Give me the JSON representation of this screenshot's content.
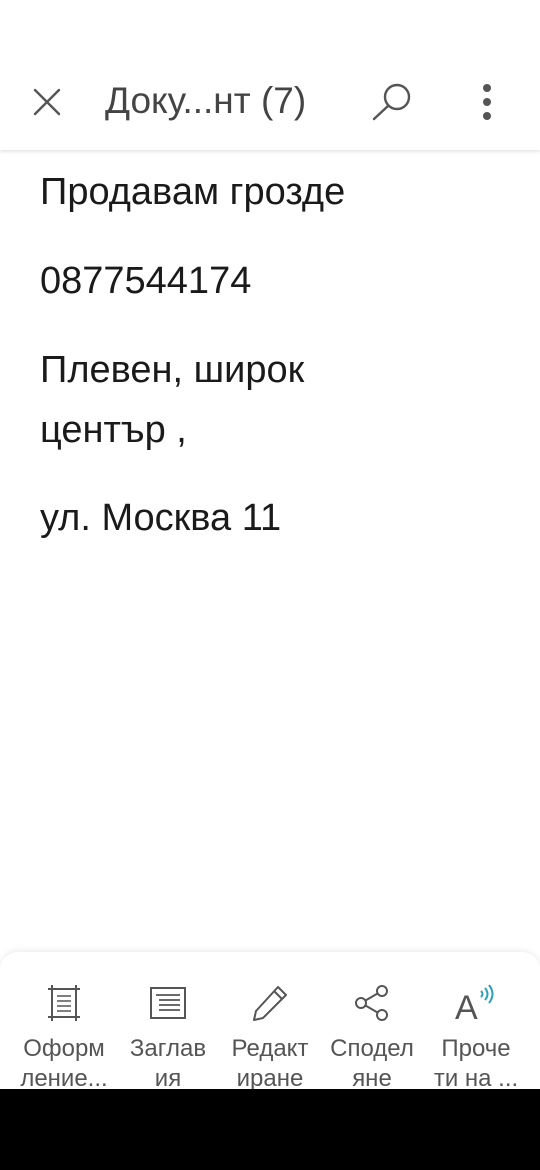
{
  "app_bar": {
    "title": "Доку...нт (7)",
    "close_icon": "close-icon",
    "search_icon": "search-icon",
    "more_icon": "more-vertical-icon"
  },
  "document": {
    "paragraphs": [
      "Продавам грозде",
      "0877544174",
      "Плевен, широк\nцентър ,",
      "ул. Москва 11"
    ]
  },
  "toolbar": {
    "items": [
      {
        "label": "Оформ\nление...",
        "icon": "layout-icon"
      },
      {
        "label": "Заглав\nия",
        "icon": "headings-icon"
      },
      {
        "label": "Редакт\nиране",
        "icon": "pencil-icon"
      },
      {
        "label": "Сподел\nяне",
        "icon": "share-icon"
      },
      {
        "label": "Проче\nти на ...",
        "icon": "read-aloud-icon"
      }
    ]
  },
  "colors": {
    "title_text": "#444444",
    "body_text": "#1a1a1a",
    "toolbar_text": "#555555",
    "read_aloud_accent": "#2aa1b8"
  }
}
